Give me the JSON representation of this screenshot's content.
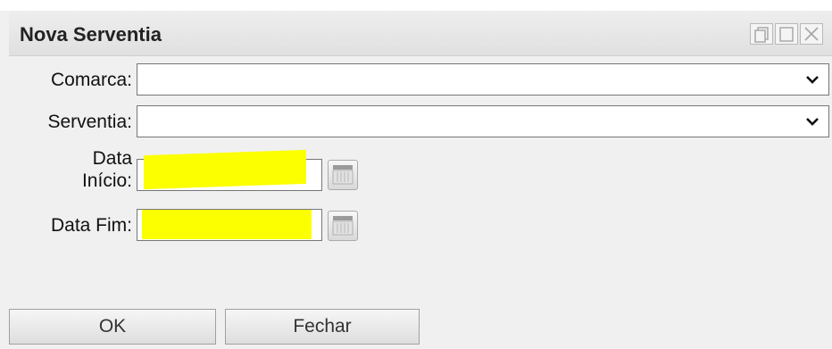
{
  "window": {
    "title": "Nova Serventia",
    "controls": [
      "restore-icon",
      "maximize-icon",
      "close-icon"
    ]
  },
  "form": {
    "comarca_label": "Comarca:",
    "comarca_value": "",
    "serventia_label": "Serventia:",
    "serventia_value": "",
    "data_inicio_label_line1": "Data",
    "data_inicio_label_line2": "Início:",
    "data_inicio_value": "",
    "data_fim_label": "Data Fim:",
    "data_fim_value": ""
  },
  "buttons": {
    "ok_label": "OK",
    "fechar_label": "Fechar"
  },
  "colors": {
    "highlight": "#fbff00",
    "background": "#f0f0f0"
  }
}
